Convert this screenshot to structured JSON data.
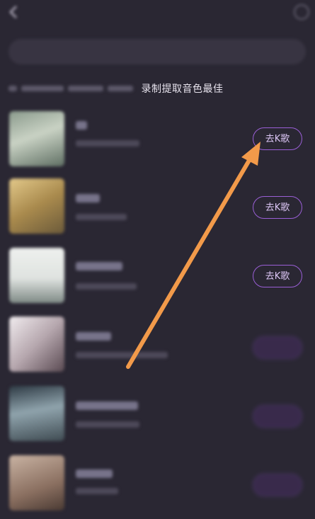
{
  "header": {
    "title": "",
    "back_icon": "chevron-left-icon",
    "settings_icon": "gear-icon"
  },
  "search": {
    "placeholder": ""
  },
  "hint": {
    "visible_text": "录制提取音色最佳"
  },
  "songs": [
    {
      "button_label": "去K歌"
    },
    {
      "button_label": "去K歌"
    },
    {
      "button_label": "去K歌"
    },
    {
      "button_label": ""
    },
    {
      "button_label": ""
    },
    {
      "button_label": ""
    }
  ],
  "colors": {
    "background": "#2a2733",
    "button_border": "#9a5fd6",
    "arrow": "#f29a4a"
  }
}
